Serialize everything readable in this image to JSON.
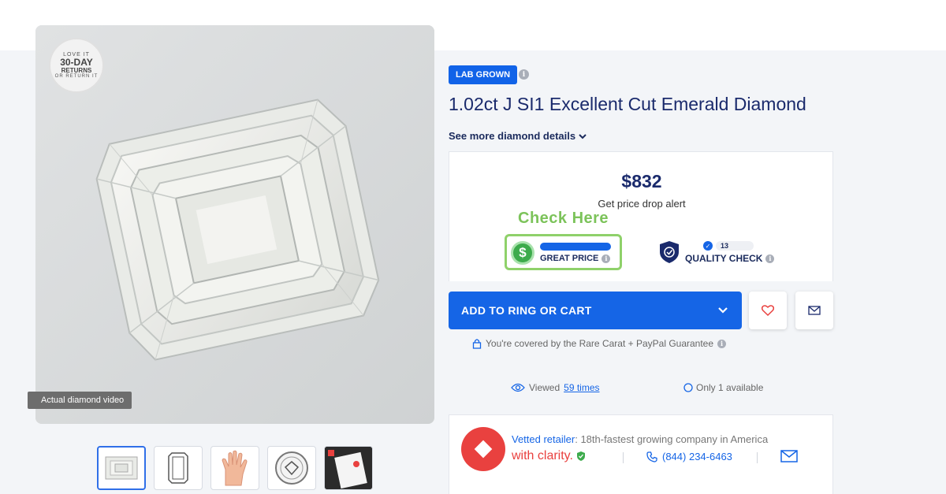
{
  "media": {
    "returns_badge": {
      "line1": "LOVE IT",
      "line2": "30-DAY",
      "line3": "RETURNS",
      "line4": "OR RETURN IT"
    },
    "video_label": "Actual diamond video",
    "thumbnails": [
      "emerald-cut-diamond",
      "diamond-outline",
      "hand-with-ring",
      "certificate-seal",
      "certificate-document"
    ]
  },
  "product": {
    "tag": "LAB GROWN",
    "title": "1.02ct J SI1 Excellent Cut Emerald Diamond",
    "details_link": "See more diamond details",
    "price": "$832",
    "price_alert": "Get price drop alert"
  },
  "annotation": {
    "check_here": "Check Here",
    "highlight_color": "#8fd16a"
  },
  "badges": {
    "great_price": "GREAT PRICE",
    "quality_check": "QUALITY CHECK",
    "quality_pill": "13"
  },
  "actions": {
    "add_to_cart": "ADD TO RING OR CART",
    "guarantee": "You're covered by the Rare Carat + PayPal Guarantee"
  },
  "stats": {
    "viewed_prefix": "Viewed",
    "viewed_link": "59 times",
    "availability": "Only 1 available"
  },
  "retailer": {
    "vetted_label": "Vetted retailer",
    "vetted_text": ": 18th-fastest growing company in America",
    "name": "with clarity.",
    "phone": "(844) 234-6463"
  },
  "colors": {
    "accent": "#1565e6",
    "retailer_red": "#e9413f",
    "great_green": "#3dab4c"
  }
}
